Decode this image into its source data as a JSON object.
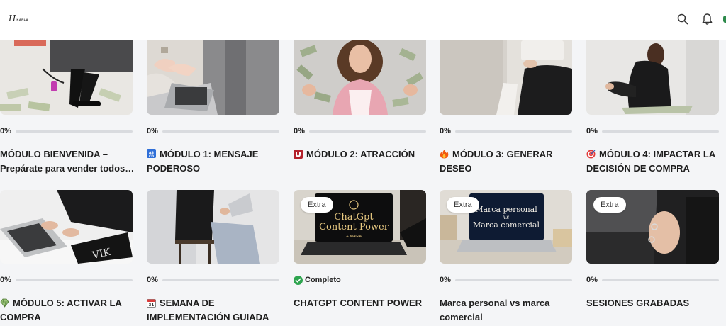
{
  "header": {
    "logo_mark": "H",
    "logo_text": "KARLA",
    "search_icon": "search-icon",
    "bell_icon": "bell-icon"
  },
  "colors": {
    "progress_fill": "#2ea44f",
    "progress_track": "#d9dbdf",
    "background": "#f4f5f7"
  },
  "modules": [
    {
      "progress": "0%",
      "progress_value": 0,
      "line1": "MÓDULO BIENVENIDA –",
      "line2": "Prepárate para vender todos…",
      "icon": ""
    },
    {
      "progress": "0%",
      "progress_value": 0,
      "line1": "MÓDULO 1: MENSAJE",
      "line2": "PODEROSO",
      "icon": "abcd-icon"
    },
    {
      "progress": "0%",
      "progress_value": 0,
      "line1": "MÓDULO 2: ATRACCIÓN",
      "line2": "",
      "icon": "magnet-icon"
    },
    {
      "progress": "0%",
      "progress_value": 0,
      "line1": "MÓDULO 3: GENERAR",
      "line2": "DESEO",
      "icon": "fire-icon"
    },
    {
      "progress": "0%",
      "progress_value": 0,
      "line1": "MÓDULO 4: IMPACTAR LA",
      "line2": "DECISIÓN DE COMPRA",
      "icon": "target-icon"
    },
    {
      "progress": "0%",
      "progress_value": 0,
      "line1": "MÓDULO 5: ACTIVAR LA",
      "line2": "COMPRA",
      "icon": "gem-icon"
    },
    {
      "progress": "0%",
      "progress_value": 0,
      "line1": "SEMANA DE",
      "line2": "IMPLEMENTACIÓN GUIADA",
      "icon": "calendar-icon"
    },
    {
      "progress": "Completo",
      "progress_value": 1,
      "line1": "CHATGPT CONTENT POWER",
      "line2": "",
      "icon": "",
      "badge": "Extra",
      "thumb_title1": "ChatGpt",
      "thumb_title2": "Content Power",
      "thumb_sub": "+ MAGIA"
    },
    {
      "progress": "0%",
      "progress_value": 0,
      "line1": "Marca personal vs marca",
      "line2": "comercial",
      "icon": "",
      "badge": "Extra",
      "thumb_title1": "Marca personal",
      "thumb_vs": "vs",
      "thumb_title2": "Marca comercial"
    },
    {
      "progress": "0%",
      "progress_value": 0,
      "line1": "SESIONES GRABADAS",
      "line2": "",
      "icon": "",
      "badge": "Extra"
    }
  ]
}
